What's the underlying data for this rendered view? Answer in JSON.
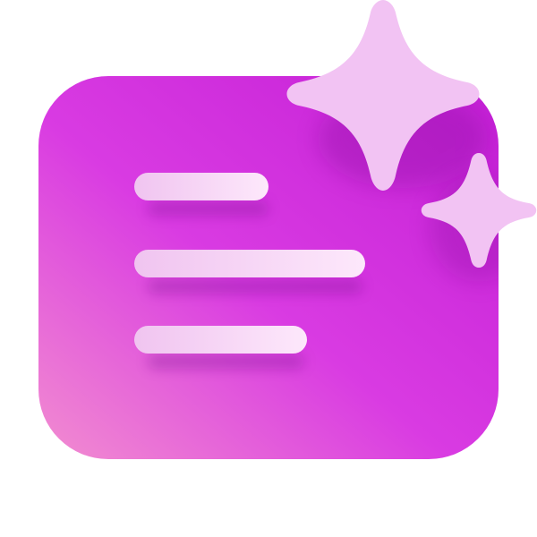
{
  "icon": {
    "name": "ai-text-summary-sparkle-icon",
    "colors": {
      "card_gradient_top_right": "#c41fd6",
      "card_gradient_mid": "#d93be2",
      "card_gradient_bottom_left": "#f28dd0",
      "line_fill_left": "#f0c4f0",
      "line_fill_right": "#fde8fb",
      "sparkle_fill": "#f2c3f3"
    },
    "text_lines": 3,
    "sparkles": 2
  }
}
